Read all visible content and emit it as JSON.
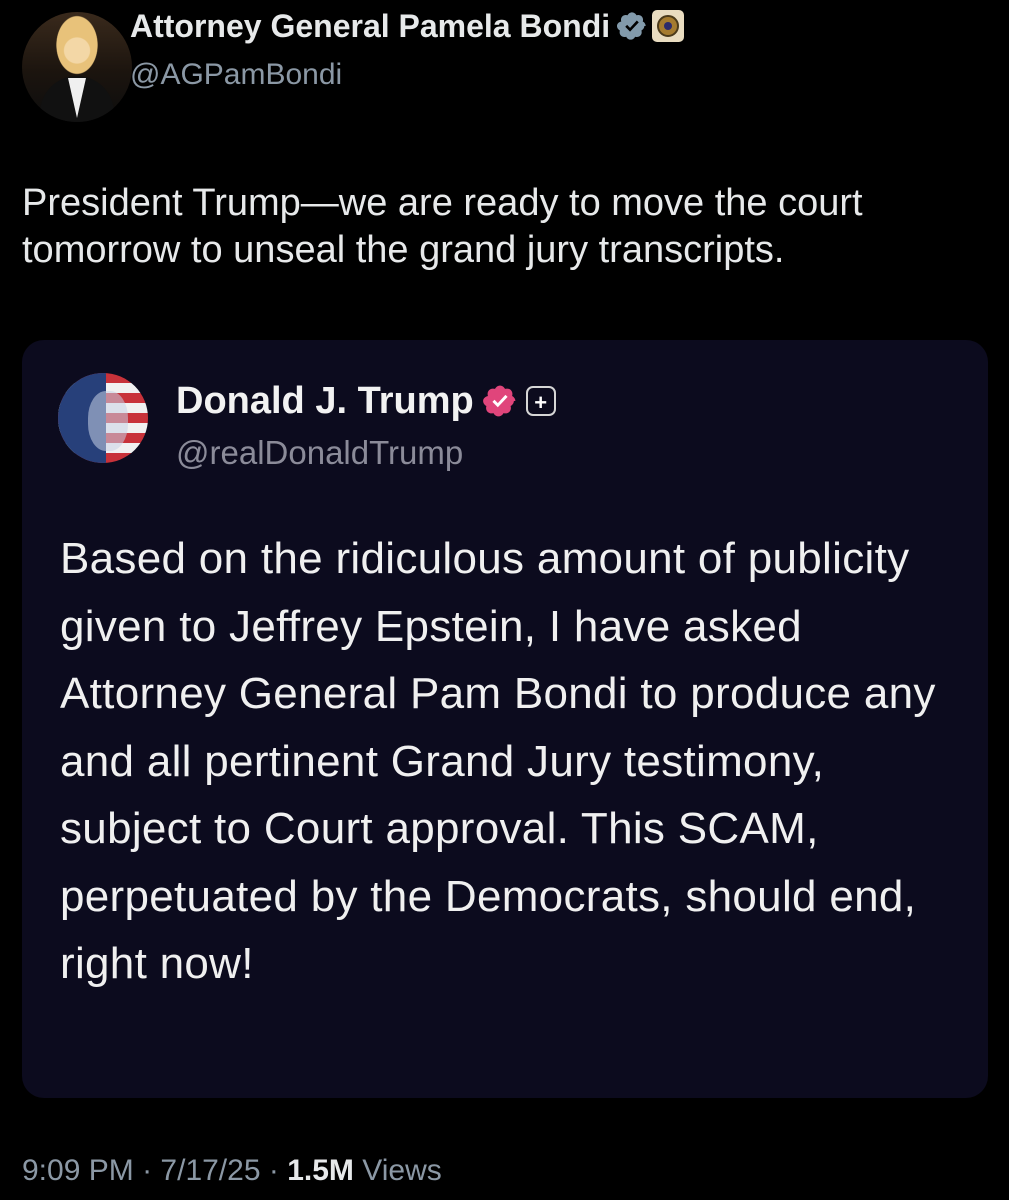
{
  "author": {
    "display_name": "Attorney General Pamela Bondi",
    "handle": "@AGPamBondi",
    "verified_icon": "verified-badge-icon",
    "affiliation_icon": "doj-seal-icon"
  },
  "tweet": {
    "text": "President Trump—we are ready to move the court tomorrow to unseal the grand jury transcripts."
  },
  "quoted": {
    "display_name": "Donald J. Trump",
    "handle": "@realDonaldTrump",
    "verified_icon": "verified-badge-icon",
    "plus_icon": "truth-social-plus-icon",
    "text": "Based on the ridiculous amount of publicity given to Jeffrey Epstein, I have asked Attorney General Pam Bondi to produce any and all pertinent Grand Jury testimony, subject to Court approval. This SCAM, perpetuated by the Democrats, should end, right now!"
  },
  "meta": {
    "time": "9:09 PM",
    "separator": "·",
    "date": "7/17/25",
    "views_count": "1.5M",
    "views_label": "Views"
  },
  "colors": {
    "background": "#000000",
    "quote_background": "#0c0b1e",
    "verified_blue_grey": "#829aab",
    "verified_pink": "#e0457b",
    "muted_text": "#8b98a5"
  }
}
